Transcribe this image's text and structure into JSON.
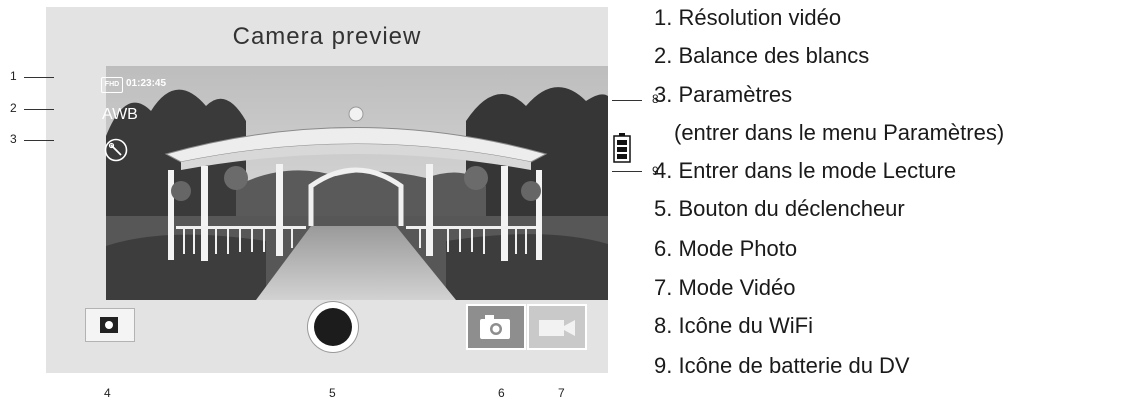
{
  "screen": {
    "title": "Camera preview",
    "timecode": "01:23:45",
    "resolution_badge": "FHD",
    "white_balance": "AWB"
  },
  "icons": {
    "resolution": "fhd-badge",
    "white_balance": "awb-text",
    "settings": "settings-icon",
    "playback": "playback-icon",
    "shutter": "shutter-button",
    "photo_mode": "camera-icon",
    "video_mode": "video-camera-icon",
    "wifi": "wifi-icon",
    "battery": "battery-icon"
  },
  "callouts": [
    "1",
    "2",
    "3",
    "4",
    "5",
    "6",
    "7",
    "8",
    "9"
  ],
  "legend": [
    "1. Résolution vidéo",
    "2. Balance des blancs",
    "3. Paramètres",
    "(entrer dans le menu Paramètres)",
    "4. Entrer dans le mode Lecture",
    "5. Bouton du déclencheur",
    "6. Mode Photo",
    "7. Mode Vidéo",
    "8. Icône du WiFi",
    "9. Icône de batterie du DV"
  ],
  "colors": {
    "panel": "#e3e3e3",
    "photo_mode_active": "#8e8e8e",
    "video_mode": "#c9c9c9",
    "shutter": "#1c1c1c"
  }
}
